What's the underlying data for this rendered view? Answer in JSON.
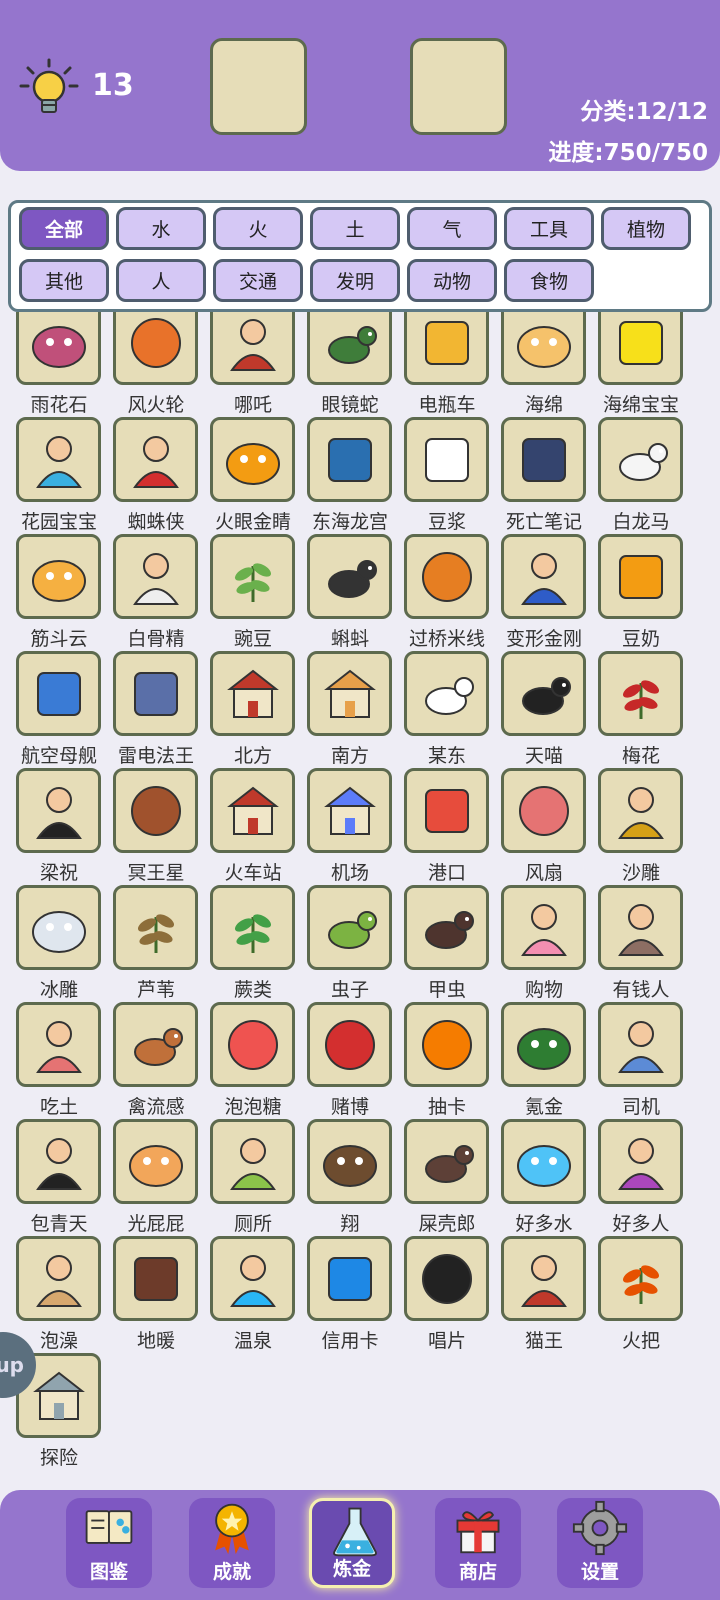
{
  "header": {
    "hint_count": "13",
    "category_stat": "分类:12/12",
    "progress_stat": "进度:750/750"
  },
  "categories": [
    "全部",
    "水",
    "火",
    "土",
    "气",
    "工具",
    "植物",
    "其他",
    "人",
    "交通",
    "发明",
    "动物",
    "食物"
  ],
  "active_category": "全部",
  "items": [
    {
      "name": "雨花石",
      "icon": "pebbles-icon",
      "color": "#c0507a"
    },
    {
      "name": "风火轮",
      "icon": "fire-wheels-icon",
      "color": "#e8722a"
    },
    {
      "name": "哪吒",
      "icon": "nezha-icon",
      "color": "#c0392b"
    },
    {
      "name": "眼镜蛇",
      "icon": "cobra-icon",
      "color": "#3f7d3a"
    },
    {
      "name": "电瓶车",
      "icon": "scooter-icon",
      "color": "#f2b632"
    },
    {
      "name": "海绵",
      "icon": "sponge-icon",
      "color": "#f5c26b"
    },
    {
      "name": "海绵宝宝",
      "icon": "spongebob-icon",
      "color": "#f7e01a"
    },
    {
      "name": "花园宝宝",
      "icon": "garden-baby-icon",
      "color": "#3ab0e0"
    },
    {
      "name": "蜘蛛侠",
      "icon": "spiderman-icon",
      "color": "#d32f2f"
    },
    {
      "name": "火眼金睛",
      "icon": "fire-eyes-icon",
      "color": "#f39c12"
    },
    {
      "name": "东海龙宫",
      "icon": "dragon-palace-icon",
      "color": "#2a6fb0"
    },
    {
      "name": "豆浆",
      "icon": "soymilk-icon",
      "color": "#ffffff"
    },
    {
      "name": "死亡笔记",
      "icon": "death-note-icon",
      "color": "#34446e"
    },
    {
      "name": "白龙马",
      "icon": "white-horse-icon",
      "color": "#f5f5f5"
    },
    {
      "name": "筋斗云",
      "icon": "cloud-icon",
      "color": "#f5b041"
    },
    {
      "name": "白骨精",
      "icon": "bone-demon-icon",
      "color": "#eeeeee"
    },
    {
      "name": "豌豆",
      "icon": "peas-icon",
      "color": "#6ab04c"
    },
    {
      "name": "蝌蚪",
      "icon": "tadpole-icon",
      "color": "#333333"
    },
    {
      "name": "过桥米线",
      "icon": "noodles-icon",
      "color": "#e67e22"
    },
    {
      "name": "变形金刚",
      "icon": "transformer-icon",
      "color": "#2e5cc8"
    },
    {
      "name": "豆奶",
      "icon": "soy-drink-icon",
      "color": "#f39c12"
    },
    {
      "name": "航空母舰",
      "icon": "aircraft-carrier-icon",
      "color": "#3a7bd5"
    },
    {
      "name": "雷电法王",
      "icon": "thunder-king-icon",
      "color": "#5a6fa8"
    },
    {
      "name": "北方",
      "icon": "temple-heaven-icon",
      "color": "#c0392b"
    },
    {
      "name": "南方",
      "icon": "south-palace-icon",
      "color": "#e7a04a"
    },
    {
      "name": "某东",
      "icon": "jd-dog-icon",
      "color": "#ffffff"
    },
    {
      "name": "天喵",
      "icon": "black-cat-icon",
      "color": "#222222"
    },
    {
      "name": "梅花",
      "icon": "plum-blossom-icon",
      "color": "#c62828"
    },
    {
      "name": "梁祝",
      "icon": "butterfly-lovers-icon",
      "color": "#222222"
    },
    {
      "name": "冥王星",
      "icon": "pluto-icon",
      "color": "#a0522d"
    },
    {
      "name": "火车站",
      "icon": "train-station-icon",
      "color": "#c0392b"
    },
    {
      "name": "机场",
      "icon": "airport-icon",
      "color": "#5c7cfa"
    },
    {
      "name": "港口",
      "icon": "harbor-icon",
      "color": "#e74c3c"
    },
    {
      "name": "风扇",
      "icon": "fan-icon",
      "color": "#e57373"
    },
    {
      "name": "沙雕",
      "icon": "oscar-statue-icon",
      "color": "#d4a017"
    },
    {
      "name": "冰雕",
      "icon": "ice-swan-icon",
      "color": "#dfe6ee"
    },
    {
      "name": "芦苇",
      "icon": "reed-icon",
      "color": "#8d6e3a"
    },
    {
      "name": "蕨类",
      "icon": "fern-icon",
      "color": "#43a047"
    },
    {
      "name": "虫子",
      "icon": "caterpillar-icon",
      "color": "#7cb342"
    },
    {
      "name": "甲虫",
      "icon": "beetle-icon",
      "color": "#4e342e"
    },
    {
      "name": "购物",
      "icon": "shopping-icon",
      "color": "#f48fb1"
    },
    {
      "name": "有钱人",
      "icon": "rich-man-icon",
      "color": "#8d6e63"
    },
    {
      "name": "吃土",
      "icon": "eating-dirt-icon",
      "color": "#e57373"
    },
    {
      "name": "禽流感",
      "icon": "hen-icon",
      "color": "#c0703a"
    },
    {
      "name": "泡泡糖",
      "icon": "bubble-gum-icon",
      "color": "#ef5350"
    },
    {
      "name": "赌博",
      "icon": "chips-icon",
      "color": "#d32f2f"
    },
    {
      "name": "抽卡",
      "icon": "lucky-wheel-icon",
      "color": "#f57c00"
    },
    {
      "name": "氪金",
      "icon": "money-bag-icon",
      "color": "#2e7d32"
    },
    {
      "name": "司机",
      "icon": "driver-icon",
      "color": "#5c8bd6"
    },
    {
      "name": "包青天",
      "icon": "judge-bao-icon",
      "color": "#222222"
    },
    {
      "name": "光屁屁",
      "icon": "bare-bottom-icon",
      "color": "#f2a65a"
    },
    {
      "name": "厕所",
      "icon": "toilet-icon",
      "color": "#8bc34a"
    },
    {
      "name": "翔",
      "icon": "poop-icon",
      "color": "#6d4c2f"
    },
    {
      "name": "屎壳郎",
      "icon": "dung-beetle-icon",
      "color": "#5d4037"
    },
    {
      "name": "好多水",
      "icon": "water-puddle-icon",
      "color": "#4fc3f7"
    },
    {
      "name": "好多人",
      "icon": "crowd-icon",
      "color": "#ab47bc"
    },
    {
      "name": "泡澡",
      "icon": "bath-icon",
      "color": "#d7a86e"
    },
    {
      "name": "地暖",
      "icon": "floor-heating-icon",
      "color": "#6d3b2a"
    },
    {
      "name": "温泉",
      "icon": "hot-spring-icon",
      "color": "#29b6f6"
    },
    {
      "name": "信用卡",
      "icon": "credit-card-icon",
      "color": "#1e88e5"
    },
    {
      "name": "唱片",
      "icon": "vinyl-icon",
      "color": "#222222"
    },
    {
      "name": "猫王",
      "icon": "elvis-icon",
      "color": "#c0392b"
    },
    {
      "name": "火把",
      "icon": "torch-icon",
      "color": "#e65100"
    },
    {
      "name": "探险",
      "icon": "explorer-icon",
      "color": "#90a4ae"
    }
  ],
  "side_tab": "up",
  "nav": [
    {
      "label": "图鉴",
      "icon": "book-icon"
    },
    {
      "label": "成就",
      "icon": "medal-icon"
    },
    {
      "label": "炼金",
      "icon": "flask-icon"
    },
    {
      "label": "商店",
      "icon": "gift-icon"
    },
    {
      "label": "设置",
      "icon": "gear-icon"
    }
  ],
  "active_nav": "炼金"
}
